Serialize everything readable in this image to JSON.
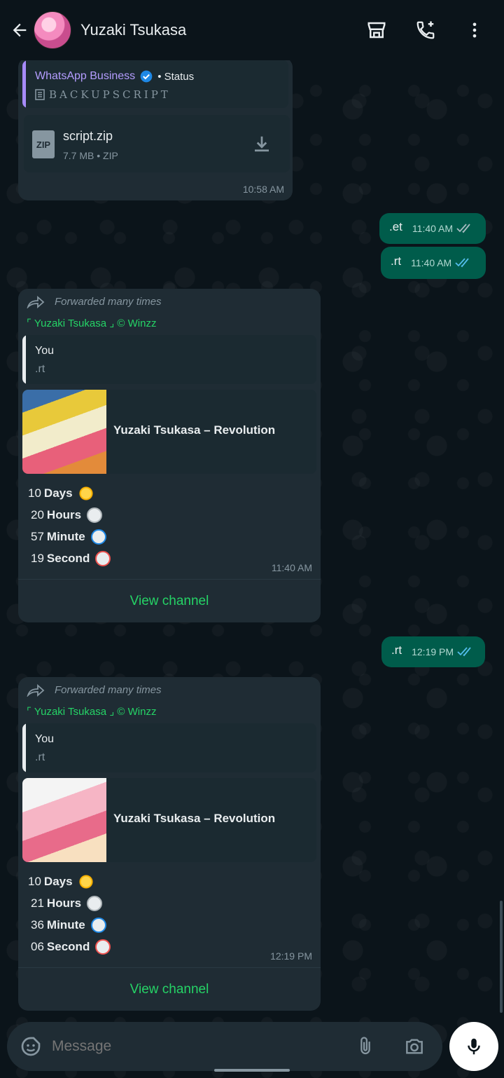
{
  "header": {
    "title": "Yuzaki Tsukasa",
    "icons": [
      "arrow-back-icon",
      "storefront-icon",
      "add-call-icon",
      "more-vert-icon"
    ]
  },
  "messages": {
    "status_reply": {
      "author": "WhatsApp Business",
      "tag": "• Status",
      "subtitle": "BACKUPSCRIPT",
      "file_name": "script.zip",
      "file_meta": "7.7 MB • ZIP",
      "file_badge": "ZIP",
      "time": "10:58 AM"
    },
    "out_1": {
      "text": ".et",
      "time": "11:40 AM",
      "ticks": "read"
    },
    "out_2": {
      "text": ".rt",
      "time": "11:40 AM",
      "ticks": "read"
    },
    "card_1": {
      "forwarded": "Forwarded many times",
      "channel": "⌜ Yuzaki Tsukasa ⌟ © Winzz",
      "quote_author": "You",
      "quote_text": ".rt",
      "preview_title": "Yuzaki Tsukasa – Revolution",
      "days_num": "10",
      "days_label": "Days",
      "hours_num": "20",
      "hours_label": "Hours",
      "minutes_num": "57",
      "minutes_label": "Minute",
      "seconds_num": "19",
      "seconds_label": "Second",
      "time": "11:40 AM",
      "button": "View channel"
    },
    "out_3": {
      "text": ".rt",
      "time": "12:19 PM",
      "ticks": "read"
    },
    "card_2": {
      "forwarded": "Forwarded many times",
      "channel": "⌜ Yuzaki Tsukasa ⌟ © Winzz",
      "quote_author": "You",
      "quote_text": ".rt",
      "preview_title": "Yuzaki Tsukasa – Revolution",
      "days_num": "10",
      "days_label": "Days",
      "hours_num": "21",
      "hours_label": "Hours",
      "minutes_num": "36",
      "minutes_label": "Minute",
      "seconds_num": "06",
      "seconds_label": "Second",
      "time": "12:19 PM",
      "button": "View channel"
    }
  },
  "composer": {
    "placeholder": "Message"
  },
  "colors": {
    "background": "#0b141a",
    "incoming": "#1f2c34",
    "outgoing": "#005c4b",
    "accent_green": "#25d366",
    "read_tick": "#53bdeb"
  }
}
